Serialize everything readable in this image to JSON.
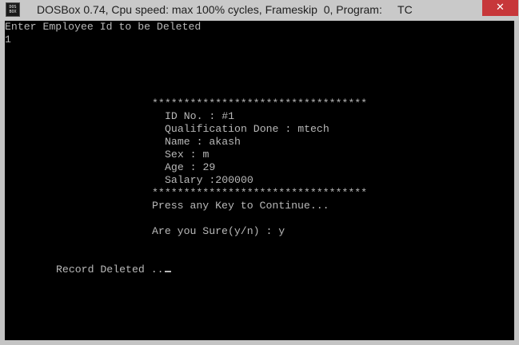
{
  "window": {
    "title": "DOSBox 0.74, Cpu speed: max 100% cycles, Frameskip  0, Program:     TC",
    "icon_text": "DOS BOX",
    "close_glyph": "✕"
  },
  "console": {
    "prompt_line": "Enter Employee Id to be Deleted",
    "input_id": "1",
    "separator_top": "**********************************",
    "record": {
      "id": "ID No. : #1",
      "qualification": "Qualification Done : mtech",
      "name": "Name : akash",
      "sex": "Sex : m",
      "age": "Age : 29",
      "salary": "Salary :200000"
    },
    "separator_bottom": "**********************************",
    "continue_prompt": "Press any Key to Continue...",
    "confirm_prompt": "Are you Sure(y/n) : y",
    "result": "Record Deleted .."
  },
  "colors": {
    "screen_bg": "#000000",
    "text": "#b8b8b8",
    "titlebar": "#c9c9c9",
    "close_button": "#c7373a"
  }
}
